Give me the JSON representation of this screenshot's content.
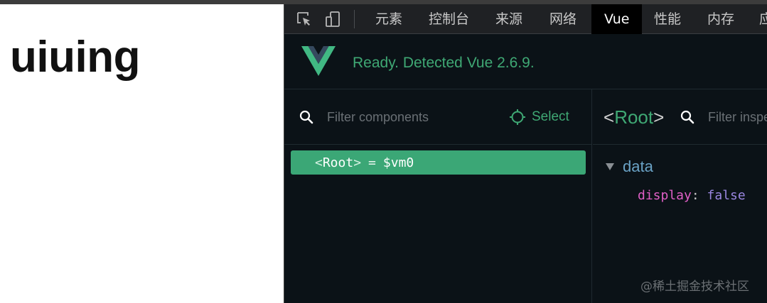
{
  "page": {
    "heading": "uiuing"
  },
  "devtools": {
    "tabs": [
      {
        "label": "元素"
      },
      {
        "label": "控制台"
      },
      {
        "label": "来源"
      },
      {
        "label": "网络"
      },
      {
        "label": "Vue",
        "active": true
      },
      {
        "label": "性能"
      },
      {
        "label": "内存"
      },
      {
        "label": "应"
      }
    ]
  },
  "vue": {
    "status": "Ready. Detected Vue 2.6.9.",
    "filter_components_placeholder": "Filter components",
    "select_label": "Select",
    "tree": {
      "root_open": "<",
      "root_name": "Root",
      "root_close": ">",
      "equals": "=",
      "vm": "$vm0"
    },
    "inspector": {
      "title_open": "<",
      "title_name": "Root",
      "title_close": ">",
      "filter_placeholder": "Filter inspected data",
      "section": "data",
      "prop_key": "display",
      "prop_colon": ":",
      "prop_value": "false"
    }
  },
  "colors": {
    "vue_green": "#3fa874",
    "selected_row": "#3ba776",
    "panel_bg": "#0b1217",
    "tabbar_bg": "#1f2124",
    "prop_key": "#e05fc6",
    "prop_value": "#9a86e0",
    "section_label": "#6aa2c5"
  },
  "watermark": "@稀土掘金技术社区"
}
